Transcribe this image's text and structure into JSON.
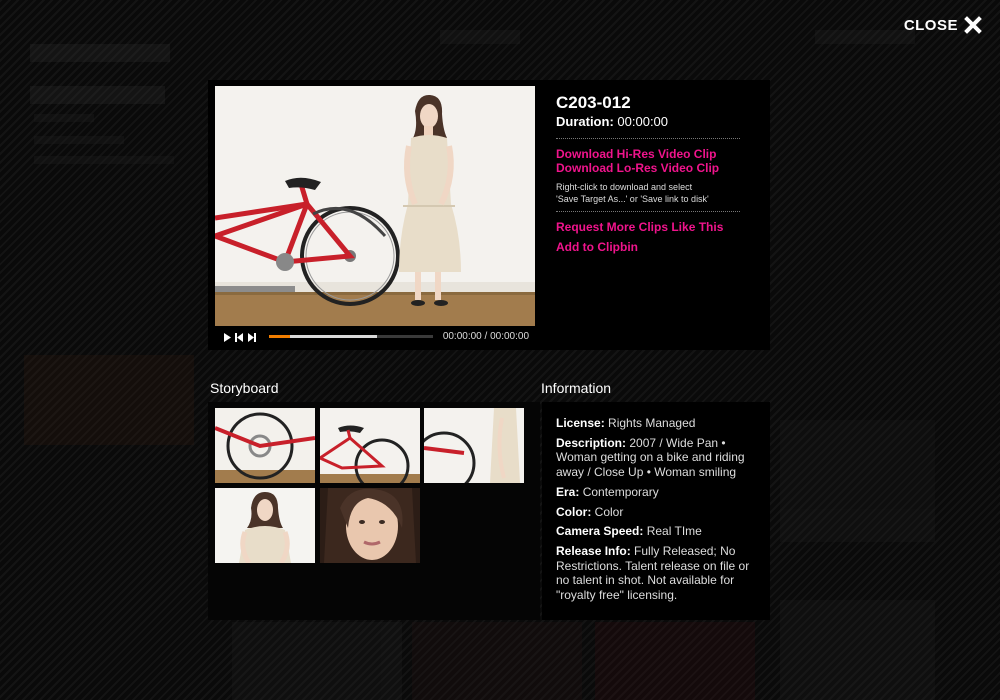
{
  "overlay": {
    "close_label": "CLOSE"
  },
  "player": {
    "time_display": "00:00:00 / 00:00:00",
    "progress_played_fraction": 0.13,
    "progress_loaded_fraction": 0.66
  },
  "clip": {
    "id": "C203-012",
    "duration_label": "Duration:",
    "duration_value": "00:00:00",
    "download_hires": "Download Hi-Res Video Clip",
    "download_lores": "Download Lo-Res Video Clip",
    "download_note_1": "Right-click to download and select",
    "download_note_2": "'Save Target As...' or 'Save link to disk'",
    "request_more": "Request More Clips Like This",
    "add_clipbin": "Add to Clipbin"
  },
  "sections": {
    "storyboard": "Storyboard",
    "information": "Information"
  },
  "info": {
    "license_label": "License:",
    "license_value": "Rights Managed",
    "description_label": "Description:",
    "description_value": "2007 / Wide Pan • Woman getting on a bike and riding away / Close Up • Woman smiling",
    "era_label": "Era:",
    "era_value": "Contemporary",
    "color_label": "Color:",
    "color_value": "Color",
    "camera_label": "Camera Speed:",
    "camera_value": "Real TIme",
    "release_label": "Release Info:",
    "release_value": "Fully Released; No Restrictions. Talent release on file or no talent in shot. Not available for \"royalty free\" licensing."
  },
  "colors": {
    "accent_pink": "#f0148c",
    "progress_orange": "#f07d00",
    "panel_bg": "#000000"
  }
}
